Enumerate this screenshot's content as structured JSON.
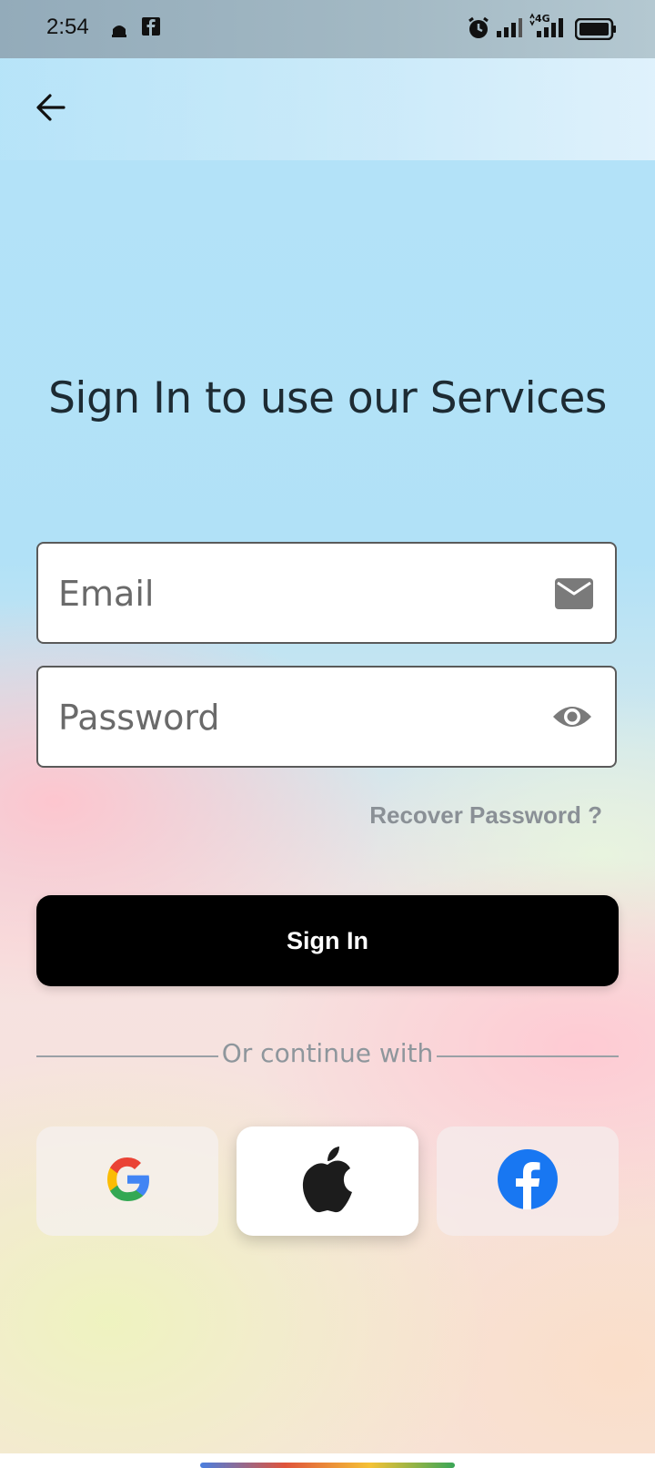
{
  "status_bar": {
    "time": "2:54",
    "left_icons": [
      "mosque-notification-icon",
      "facebook-notification-icon"
    ],
    "right_icons": [
      "alarm-icon",
      "signal-icon",
      "4g-signal-icon",
      "battery-icon"
    ],
    "network_label": "4G"
  },
  "header": {
    "back_icon": "arrow-left-icon"
  },
  "main": {
    "title": "Sign In to use our Services",
    "email": {
      "placeholder": "Email",
      "value": "",
      "icon": "mail-icon"
    },
    "password": {
      "placeholder": "Password",
      "value": "",
      "icon": "eye-icon"
    },
    "recover_label": "Recover Password ?",
    "signin_label": "Sign In",
    "divider_text": "Or continue with",
    "social": [
      {
        "name": "Google",
        "icon": "google-icon"
      },
      {
        "name": "Apple",
        "icon": "apple-icon"
      },
      {
        "name": "Facebook",
        "icon": "facebook-icon"
      }
    ]
  },
  "colors": {
    "button_bg": "#000000",
    "title": "#1d2b33",
    "muted_text": "#8a9096",
    "facebook_blue": "#1877f2"
  }
}
